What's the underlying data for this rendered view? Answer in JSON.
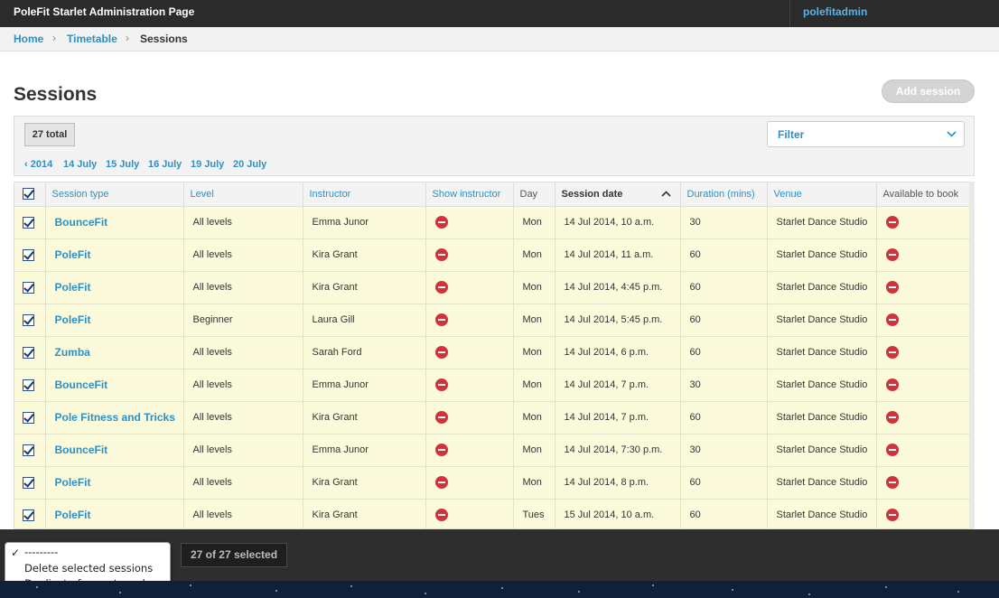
{
  "header": {
    "title": "PoleFit Starlet Administration Page",
    "user": "polefitadmin"
  },
  "breadcrumb": [
    "Home",
    "Timetable",
    "Sessions"
  ],
  "page": {
    "title": "Sessions",
    "add_button": "Add session"
  },
  "toolbar": {
    "total": "27 total",
    "filter_label": "Filter",
    "dates": [
      "2014",
      "14 July",
      "15 July",
      "16 July",
      "19 July",
      "20 July"
    ]
  },
  "table": {
    "columns": [
      "Session type",
      "Level",
      "Instructor",
      "Show instructor",
      "Day",
      "Session date",
      "Duration (mins)",
      "Venue",
      "Available to book"
    ],
    "rows": [
      [
        "BounceFit",
        "All levels",
        "Emma Junor",
        "Mon",
        "14 Jul 2014, 10 a.m.",
        "30",
        "Starlet Dance Studio"
      ],
      [
        "PoleFit",
        "All levels",
        "Kira Grant",
        "Mon",
        "14 Jul 2014, 11 a.m.",
        "60",
        "Starlet Dance Studio"
      ],
      [
        "PoleFit",
        "All levels",
        "Kira Grant",
        "Mon",
        "14 Jul 2014, 4:45 p.m.",
        "60",
        "Starlet Dance Studio"
      ],
      [
        "PoleFit",
        "Beginner",
        "Laura Gill",
        "Mon",
        "14 Jul 2014, 5:45 p.m.",
        "60",
        "Starlet Dance Studio"
      ],
      [
        "Zumba",
        "All levels",
        "Sarah Ford",
        "Mon",
        "14 Jul 2014, 6 p.m.",
        "60",
        "Starlet Dance Studio"
      ],
      [
        "BounceFit",
        "All levels",
        "Emma Junor",
        "Mon",
        "14 Jul 2014, 7 p.m.",
        "30",
        "Starlet Dance Studio"
      ],
      [
        "Pole Fitness and Tricks",
        "All levels",
        "Kira Grant",
        "Mon",
        "14 Jul 2014, 7 p.m.",
        "60",
        "Starlet Dance Studio"
      ],
      [
        "BounceFit",
        "All levels",
        "Emma Junor",
        "Mon",
        "14 Jul 2014, 7:30 p.m.",
        "30",
        "Starlet Dance Studio"
      ],
      [
        "PoleFit",
        "All levels",
        "Kira Grant",
        "Mon",
        "14 Jul 2014, 8 p.m.",
        "60",
        "Starlet Dance Studio"
      ],
      [
        "PoleFit",
        "All levels",
        "Kira Grant",
        "Tues",
        "15 Jul 2014, 10 a.m.",
        "60",
        "Starlet Dance Studio"
      ]
    ]
  },
  "actions": {
    "options": [
      "---------",
      "Delete selected sessions",
      "Duplicate for next week"
    ],
    "selected_count": "27 of 27 selected"
  },
  "colors": {
    "link": "#2f8fc4",
    "row_bg": "#fbfbdc",
    "header_bg": "#2b2b2b",
    "no_icon": "#d0343a"
  }
}
